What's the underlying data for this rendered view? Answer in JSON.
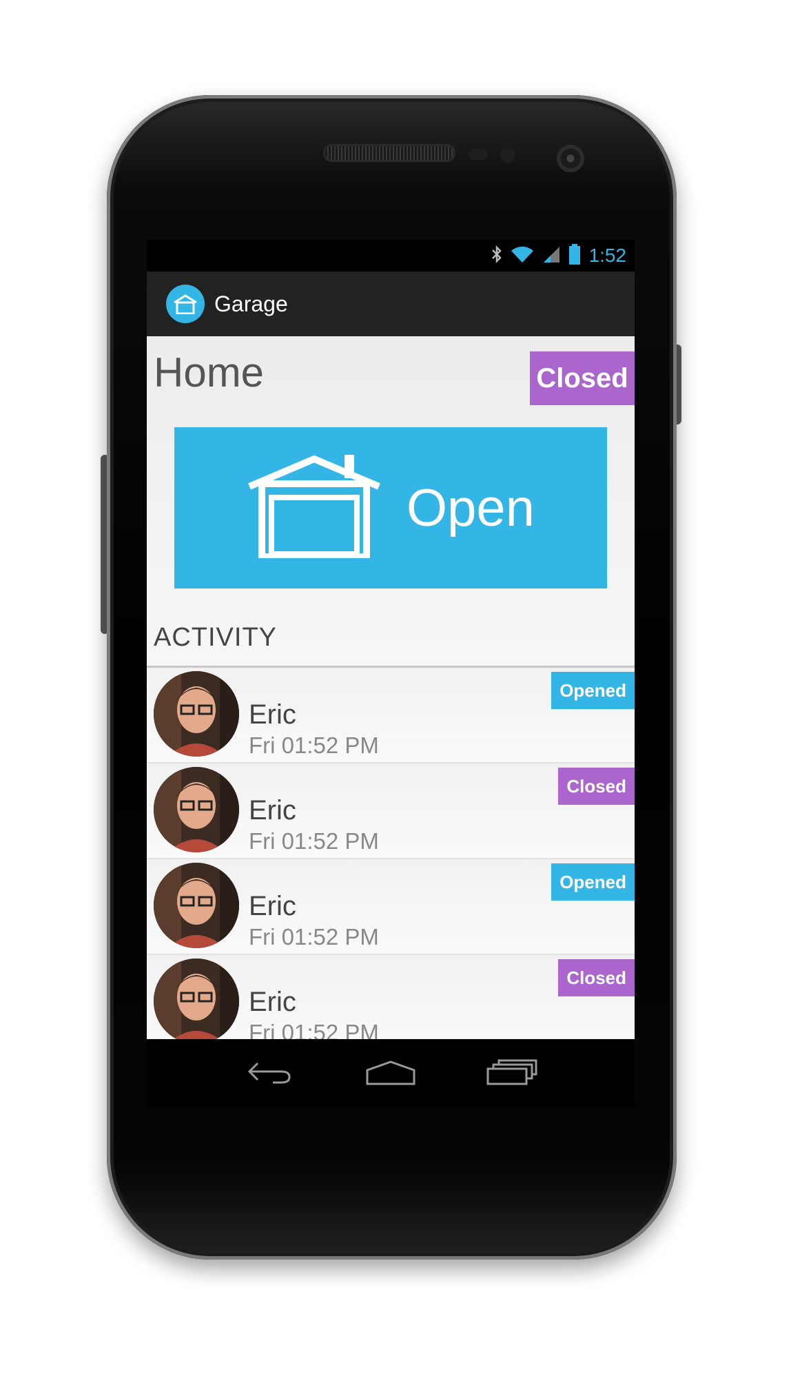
{
  "status_bar": {
    "time": "1:52"
  },
  "action_bar": {
    "title": "Garage"
  },
  "home": {
    "title": "Home",
    "door_status": "Closed",
    "door_status_color": "#aa66cc",
    "open_button_label": "Open"
  },
  "activity": {
    "header": "ACTIVITY",
    "items": [
      {
        "name": "Eric",
        "time": "Fri 01:52 PM",
        "action": "Opened",
        "action_color": "#33b5e5"
      },
      {
        "name": "Eric",
        "time": "Fri 01:52 PM",
        "action": "Closed",
        "action_color": "#aa66cc"
      },
      {
        "name": "Eric",
        "time": "Fri 01:52 PM",
        "action": "Opened",
        "action_color": "#33b5e5"
      },
      {
        "name": "Eric",
        "time": "Fri 01:52 PM",
        "action": "Closed",
        "action_color": "#aa66cc"
      }
    ]
  },
  "nav_bar": {
    "icons": [
      "back-icon",
      "home-icon",
      "recent-apps-icon"
    ]
  },
  "colors": {
    "accent": "#33b5e5",
    "closed": "#aa66cc",
    "action_bar": "#222222"
  }
}
